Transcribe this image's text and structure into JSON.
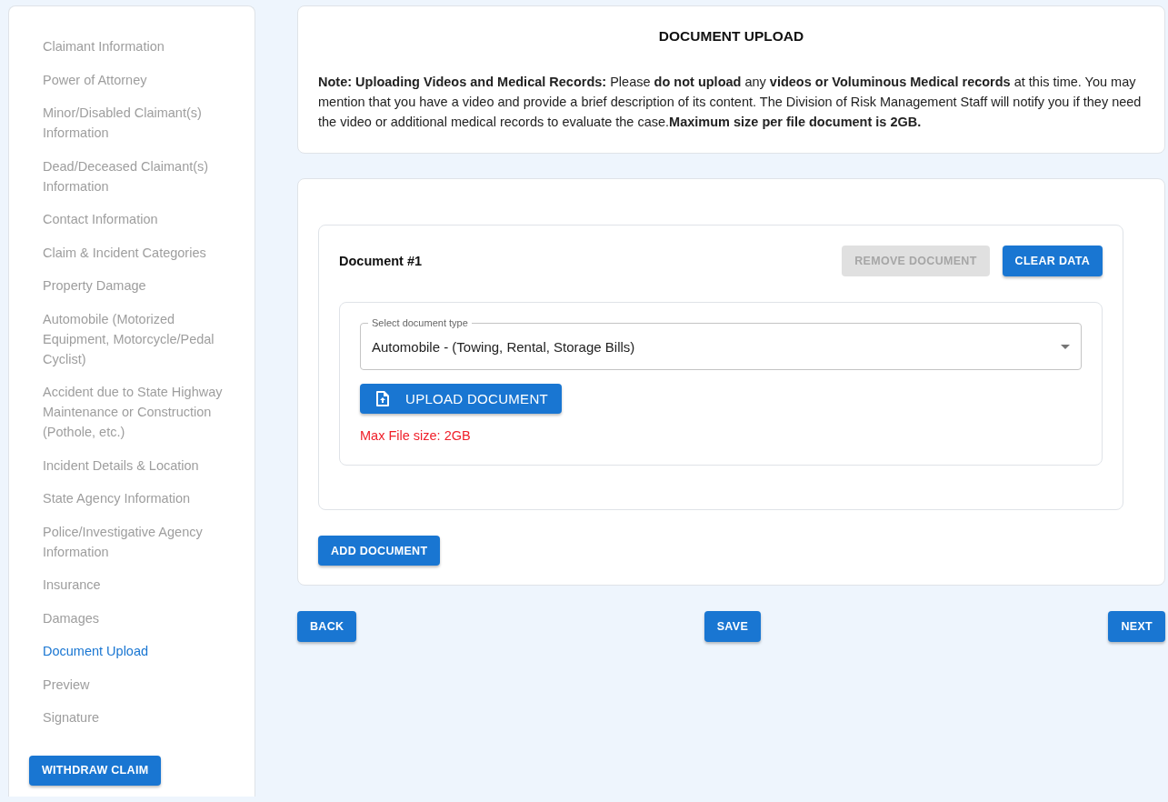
{
  "sidebar": {
    "items": [
      {
        "label": "Claimant Information",
        "selected": false
      },
      {
        "label": "Power of Attorney",
        "selected": false
      },
      {
        "label": "Minor/Disabled Claimant(s) Information",
        "selected": false
      },
      {
        "label": "Dead/Deceased Claimant(s) Information",
        "selected": false
      },
      {
        "label": "Contact Information",
        "selected": false
      },
      {
        "label": "Claim & Incident Categories",
        "selected": false
      },
      {
        "label": "Property Damage",
        "selected": false
      },
      {
        "label": "Automobile (Motorized Equipment, Motorcycle/Pedal Cyclist)",
        "selected": false
      },
      {
        "label": "Accident due to State Highway Maintenance or Construction (Pothole, etc.)",
        "selected": false
      },
      {
        "label": "Incident Details & Location",
        "selected": false
      },
      {
        "label": "State Agency Information",
        "selected": false
      },
      {
        "label": "Police/Investigative Agency Information",
        "selected": false
      },
      {
        "label": "Insurance",
        "selected": false
      },
      {
        "label": "Damages",
        "selected": false
      },
      {
        "label": "Document Upload",
        "selected": true
      },
      {
        "label": "Preview",
        "selected": false
      },
      {
        "label": "Signature",
        "selected": false
      }
    ],
    "withdraw_button": "WITHDRAW CLAIM"
  },
  "header": {
    "title": "DOCUMENT UPLOAD",
    "note": "**Note: Uploading Videos and Medical Records:** Please **do not upload** any **videos or Voluminous Medical records** at this time. You may mention that you have a video and provide a brief description of its content. The Division of Risk Management Staff will notify you if they need the video or additional medical records to evaluate the case.**Maximum size per file document is 2GB.**"
  },
  "documents": [
    {
      "title": "Document #1",
      "remove_button": {
        "label": "REMOVE DOCUMENT",
        "disabled": true
      },
      "clear_button": "CLEAR DATA",
      "type_field": {
        "label": "Select document type",
        "value": "Automobile - (Towing, Rental, Storage Bills)"
      },
      "upload_button": "UPLOAD DOCUMENT",
      "size_note": "Max File size: 2GB"
    }
  ],
  "add_button": "ADD DOCUMENT",
  "nav_buttons": [
    "BACK",
    "SAVE",
    "NEXT"
  ]
}
